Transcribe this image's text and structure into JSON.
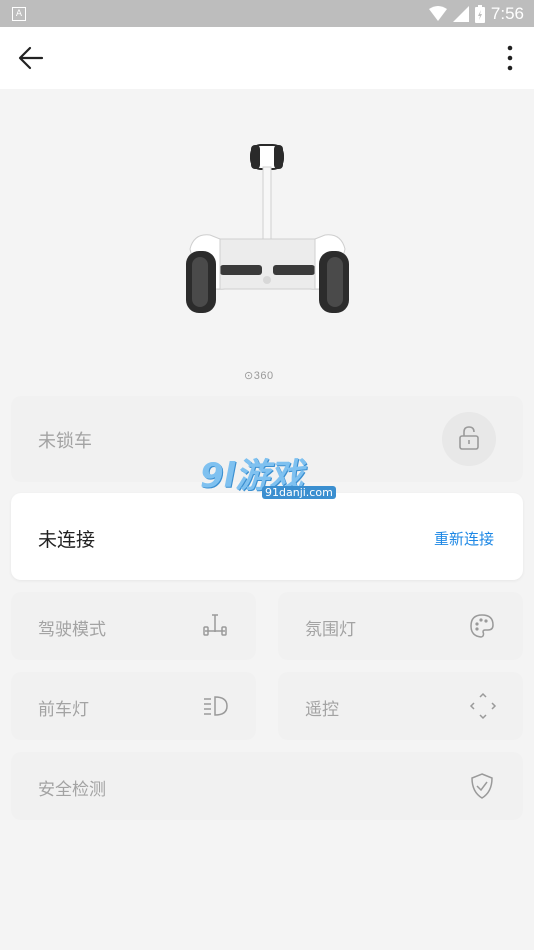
{
  "status_bar": {
    "time": "7:56",
    "app_badge": "A"
  },
  "app_bar": {
    "back_icon": "arrow-left-icon",
    "menu_icon": "more-vert-icon"
  },
  "hero": {
    "brand": "⊙360"
  },
  "lock_card": {
    "label": "未锁车",
    "icon": "unlock-icon"
  },
  "connection_card": {
    "status": "未连接",
    "action": "重新连接",
    "accent": "#1e88e5"
  },
  "features": [
    {
      "label": "驾驶模式",
      "icon": "scooter-mode-icon"
    },
    {
      "label": "氛围灯",
      "icon": "palette-icon"
    },
    {
      "label": "前车灯",
      "icon": "headlight-icon"
    },
    {
      "label": "遥控",
      "icon": "remote-control-icon"
    },
    {
      "label": "安全检测",
      "icon": "shield-check-icon"
    }
  ],
  "watermark": {
    "main": "9l游戏",
    "sub": "91danji.com"
  }
}
